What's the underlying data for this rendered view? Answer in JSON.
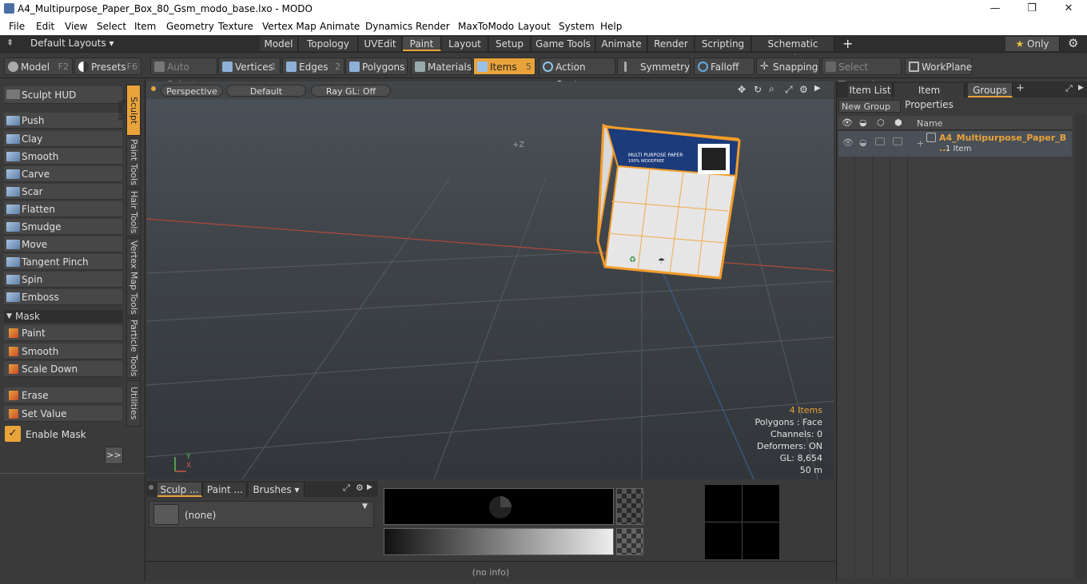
{
  "window": {
    "title": "A4_Multipurpose_Paper_Box_80_Gsm_modo_base.lxo - MODO",
    "minimize": "—",
    "restore": "❐",
    "close": "✕"
  },
  "menu": [
    "File",
    "Edit",
    "View",
    "Select",
    "Item",
    "Geometry",
    "Texture",
    "Vertex Map",
    "Animate",
    "Dynamics",
    "Render",
    "MaxToModo",
    "Layout",
    "System",
    "Help"
  ],
  "layoutbar": {
    "layouts": "Default Layouts",
    "tabs": [
      "Model",
      "Topology",
      "UVEdit",
      "Paint",
      "Layout",
      "Setup",
      "Game Tools",
      "Animate",
      "Render",
      "Scripting",
      "Schematic Fusion"
    ],
    "add": "+",
    "only": "Only"
  },
  "toolbar": {
    "model": "Model",
    "model_key": "F2",
    "presets": "Presets",
    "presets_key": "F6",
    "auto_select": "Auto Select",
    "vertices": "Vertices",
    "vertices_key": "1",
    "edges": "Edges",
    "edges_key": "2",
    "polygons": "Polygons",
    "materials": "Materials",
    "items": "Items",
    "items_key": "5",
    "action_center": "Action Center",
    "symmetry": "Symmetry",
    "falloff": "Falloff",
    "snapping": "Snapping",
    "select_through": "Select Through",
    "workplane": "WorkPlane"
  },
  "sculpt": {
    "hud": "Sculpt HUD",
    "tools": [
      "Push",
      "Clay",
      "Smooth",
      "Carve",
      "Scar",
      "Flatten",
      "Smudge",
      "Move",
      "Tangent Pinch",
      "Spin",
      "Emboss"
    ],
    "mask_header": "Mask",
    "mask_tools": [
      "Paint",
      "Smooth",
      "Scale Down"
    ],
    "mask_tools2": [
      "Erase",
      "Set Value"
    ],
    "enable_mask": "Enable Mask",
    "more": ">>"
  },
  "vtabs": [
    "Sculpt Tools",
    "Paint Tools",
    "Hair Tools",
    "Vertex Map Tools",
    "Particle Tools",
    "Utilities"
  ],
  "viewport": {
    "view": "Perspective",
    "shading": "Default",
    "raygl": "Ray GL: Off",
    "axis_label": "+Z",
    "box_text1": "MULTI PURPOSE PAPER",
    "box_text2": "100% WOODFREE",
    "info": {
      "items": "4 Items",
      "polygons": "Polygons : Face",
      "channels": "Channels: 0",
      "deformers": "Deformers: ON",
      "gl": "GL: 8,654",
      "scale": "50 m"
    }
  },
  "bottom": {
    "tabs": [
      "Sculp ...",
      "Paint ...",
      "Brushes"
    ],
    "brush": "(none)"
  },
  "right": {
    "tabs": [
      "Item List",
      "Item Properties",
      "Groups"
    ],
    "new_group": "New Group",
    "col_name": "Name",
    "group_name": "A4_Multipurpose_Paper_B ...",
    "group_count": "1 Item"
  },
  "status": "(no info)",
  "colors": {
    "accent": "#e8a33a",
    "box_blue": "#1c3b7a"
  }
}
